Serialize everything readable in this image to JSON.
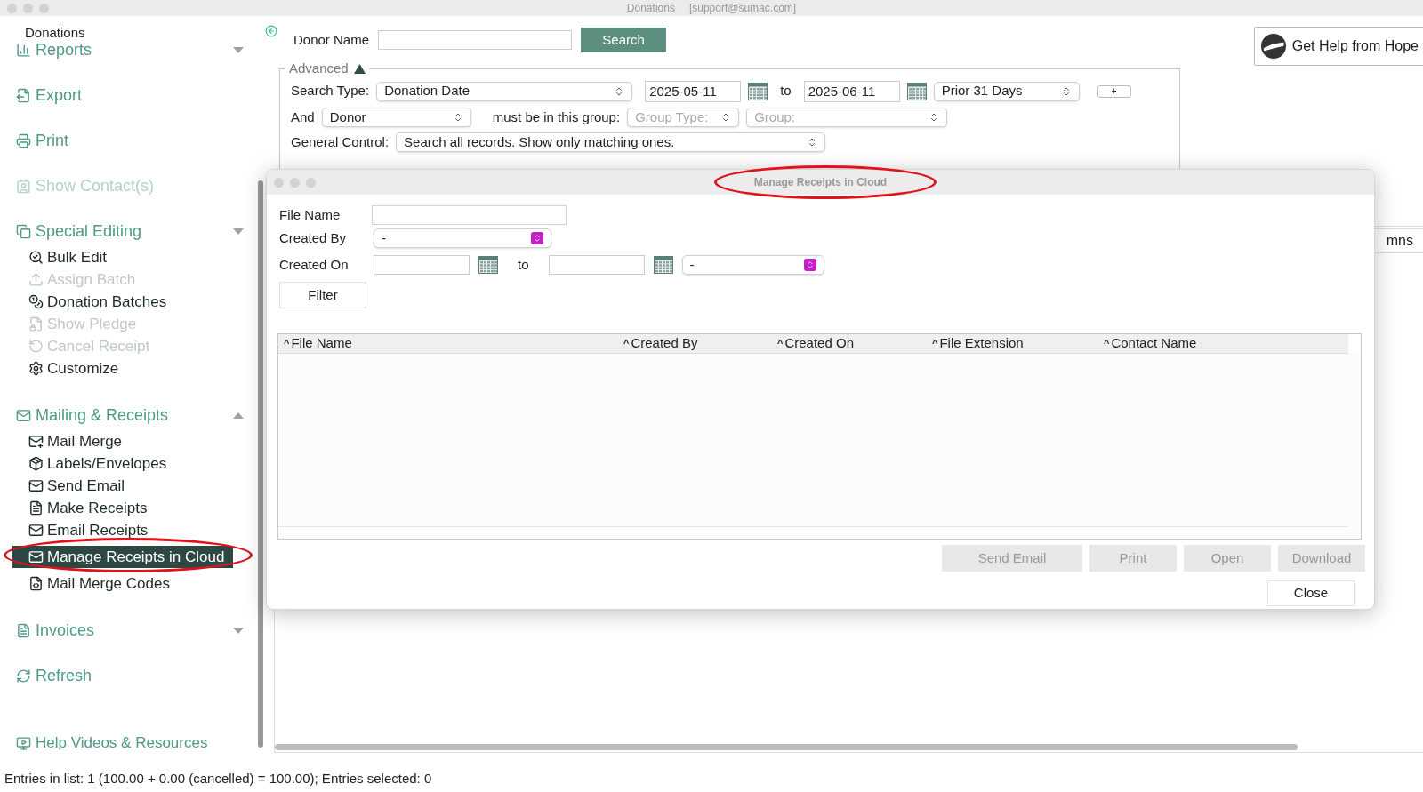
{
  "window": {
    "title": "Donations",
    "account": "[support@sumac.com]"
  },
  "sidebar": {
    "title": "Donations",
    "items": [
      {
        "label": "Reports",
        "disabled": false,
        "caret_up": false
      },
      {
        "label": "Export",
        "disabled": false
      },
      {
        "label": "Print",
        "disabled": false
      },
      {
        "label": "Show Contact(s)",
        "disabled": true
      },
      {
        "label": "Special Editing",
        "disabled": false,
        "caret_up": false,
        "children": [
          {
            "label": "Bulk Edit",
            "disabled": false,
            "selected": false
          },
          {
            "label": "Assign Batch",
            "disabled": true,
            "selected": false
          },
          {
            "label": "Donation Batches",
            "disabled": false,
            "selected": false
          },
          {
            "label": "Show Pledge",
            "disabled": true,
            "selected": false
          },
          {
            "label": "Cancel Receipt",
            "disabled": true,
            "selected": false
          },
          {
            "label": "Customize",
            "disabled": false,
            "selected": false
          }
        ]
      },
      {
        "label": "Mailing & Receipts",
        "disabled": false,
        "caret_up": true,
        "children": [
          {
            "label": "Mail Merge",
            "disabled": false,
            "selected": false
          },
          {
            "label": "Labels/Envelopes",
            "disabled": false,
            "selected": false
          },
          {
            "label": "Send Email",
            "disabled": false,
            "selected": false
          },
          {
            "label": "Make Receipts",
            "disabled": false,
            "selected": false
          },
          {
            "label": "Email Receipts",
            "disabled": false,
            "selected": false
          },
          {
            "label": "Manage Receipts in Cloud",
            "disabled": false,
            "selected": true,
            "annotated": true
          },
          {
            "label": "Mail Merge Codes",
            "disabled": false,
            "selected": false
          }
        ]
      },
      {
        "label": "Invoices",
        "disabled": false,
        "caret_up": false
      },
      {
        "label": "Refresh",
        "disabled": false
      }
    ],
    "footer_link": "Help Videos & Resources"
  },
  "search": {
    "label": "Donor Name",
    "button": "Search"
  },
  "help_button": "Get Help from Hope",
  "advanced": {
    "label": "Advanced",
    "expanded": true,
    "search_type_label": "Search Type:",
    "search_type": "Donation Date",
    "from": "2025-05-11",
    "to_label": "to",
    "to": "2025-06-11",
    "period": "Prior 31 Days",
    "add_button": "+",
    "and_label": "And",
    "and_value": "Donor",
    "group_label": "must be in this group:",
    "group_type": {
      "placeholder": "Group Type:",
      "disabled": true
    },
    "group": {
      "placeholder": "Group:",
      "disabled": true
    },
    "general_label": "General Control:",
    "general_value": "Search all records. Show only matching ones."
  },
  "background_list": {
    "columns_button": "mns"
  },
  "dialog": {
    "title": "Manage Receipts in Cloud",
    "annotated": true,
    "file_name_label": "File Name",
    "created_by_label": "Created By",
    "created_by_value": "-",
    "created_on_label": "Created On",
    "to_label": "to",
    "range_value": "-",
    "filter_button": "Filter",
    "sort_icon": "^",
    "columns": [
      "File Name",
      "Created By",
      "Created On",
      "File Extension",
      "Contact Name"
    ],
    "actions": [
      {
        "label": "Send Email",
        "disabled": true
      },
      {
        "label": "Print",
        "disabled": true
      },
      {
        "label": "Open",
        "disabled": true
      },
      {
        "label": "Download",
        "disabled": true
      }
    ],
    "close_button": "Close"
  },
  "status_bar": "Entries in list: 1 (100.00 + 0.00 (cancelled) = 100.00); Entries selected: 0"
}
